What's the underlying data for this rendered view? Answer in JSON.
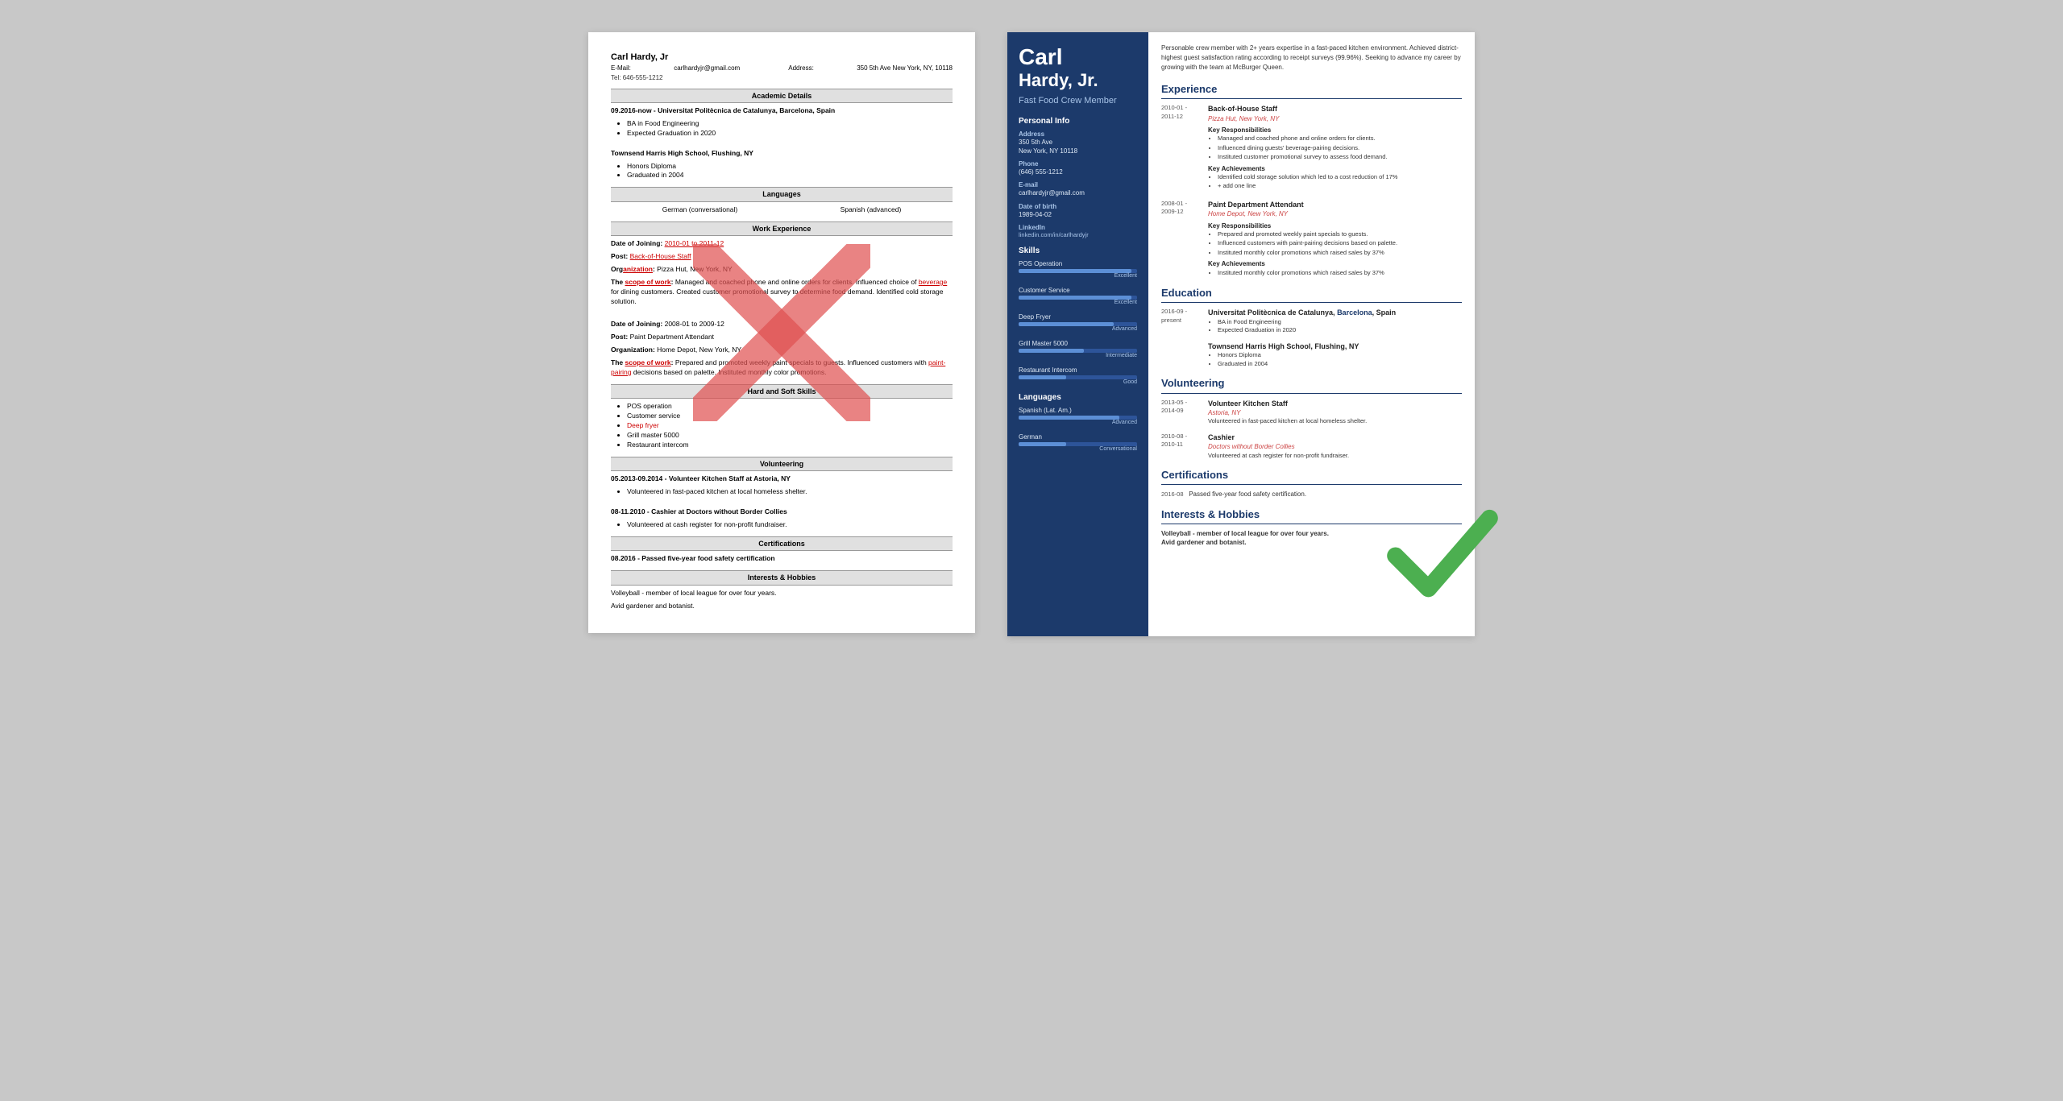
{
  "left_resume": {
    "name": "Carl Hardy, Jr",
    "email_label": "E-Mail:",
    "email": "carlhardyjr@gmail.com",
    "address_label": "Address:",
    "address": "350 5th Ave New York, NY, 10118",
    "tel_label": "Tel:",
    "tel": "646-555-1212",
    "sections": {
      "academic": "Academic Details",
      "languages": "Languages",
      "work": "Work Experience",
      "hardsoft": "Hard and Soft Skills",
      "volunteering": "Volunteering",
      "certifications": "Certifications",
      "interests": "Interests & Hobbies"
    },
    "academic_entries": [
      {
        "dates": "09.2016-now -",
        "school": "Universitat Politècnica de Catalunya, Barcelona, Spain",
        "items": [
          "BA in Food Engineering",
          "Expected Graduation in 2020"
        ]
      },
      {
        "school": "Townsend Harris High School, Flushing, NY",
        "items": [
          "Honors Diploma",
          "Graduated in 2004"
        ]
      }
    ],
    "languages": [
      "German (conversational)",
      "Spanish (advanced)"
    ],
    "work_entries": [
      {
        "dates": "Date of Joining: 2010-01 to 2011-12",
        "post": "Post: Back-of-House Staff",
        "org": "Organization: Pizza Hut, New York, NY",
        "scope": "The scope of work: Managed and coached phone and online orders for clients. Influenced choice of beverage for dining customers. Created customer promotional survey to determine food demand. Identified cold storage solution."
      },
      {
        "dates": "Date of Joining: 2008-01 to 2009-12",
        "post": "Post: Paint Department Attendant",
        "org": "Organization: Home Depot, New York, NY",
        "scope": "The scope of work: Prepared and promoted weekly paint specials to guests. Influenced customers with paint-pairing decisions based on palette. Instituted monthly color promotions."
      }
    ],
    "skills": [
      "POS operation",
      "Customer service",
      "Deep fryer",
      "Grill master 5000",
      "Restaurant intercom"
    ],
    "volunteering_entries": [
      {
        "dates": "05.2013-09.2014",
        "title": "Volunteer Kitchen Staff at Astoria, NY",
        "items": [
          "Volunteered in fast-paced kitchen at local homeless shelter."
        ]
      },
      {
        "dates": "08-11.2010",
        "title": "Cashier at Doctors without Border Collies",
        "items": [
          "Volunteered at cash register for non-profit fundraiser."
        ]
      }
    ],
    "certifications": "08.2016 - Passed five-year food safety certification",
    "interests": "Volleyball - member of local league for over four years.\nAvid gardener and botanist."
  },
  "right_resume": {
    "first_name": "Carl",
    "last_name": "Hardy, Jr.",
    "job_title": "Fast Food Crew Member",
    "intro": "Personable crew member with 2+ years expertise in a fast-paced kitchen environment. Achieved district-highest guest satisfaction rating according to receipt surveys (99.96%). Seeking to advance my career by growing with the team at McBurger Queen.",
    "personal_info": {
      "section": "Personal Info",
      "address_label": "Address",
      "address": "350 5th Ave\nNew York, NY 10118",
      "phone_label": "Phone",
      "phone": "(646) 555-1212",
      "email_label": "E-mail",
      "email": "carlhardyjr@gmail.com",
      "dob_label": "Date of birth",
      "dob": "1989-04-02",
      "linkedin_label": "LinkedIn",
      "linkedin": "linkedin.com/in/carlhardyjr"
    },
    "skills_section": "Skills",
    "skills": [
      {
        "name": "POS Operation",
        "level": "Excellent",
        "pct": 95
      },
      {
        "name": "Customer Service",
        "level": "Excellent",
        "pct": 95
      },
      {
        "name": "Deep Fryer",
        "level": "Advanced",
        "pct": 80
      },
      {
        "name": "Grill Master 5000",
        "level": "Intermediate",
        "pct": 55
      },
      {
        "name": "Restaurant Intercom",
        "level": "Good",
        "pct": 40
      }
    ],
    "languages_section": "Languages",
    "languages": [
      {
        "name": "Spanish (Lat. Am.)",
        "level": "Advanced",
        "pct": 85
      },
      {
        "name": "German",
        "level": "Conversational",
        "pct": 40
      }
    ],
    "experience": {
      "section": "Experience",
      "entries": [
        {
          "dates": "2010-01 -\n2011-12",
          "title": "Back-of-House Staff",
          "company": "Pizza Hut, New York, NY",
          "responsibilities_header": "Key Responsibilities",
          "responsibilities": [
            "Managed and coached phone and online orders for clients.",
            "Influenced dining guests' beverage-pairing decisions.",
            "Instituted customer promotional survey to assess food demand."
          ],
          "achievements_header": "Key Achievements",
          "achievements": [
            "Identified cold storage solution which led to a cost reduction of 17%",
            "+ add one line"
          ]
        },
        {
          "dates": "2008-01 -\n2009-12",
          "title": "Paint Department Attendant",
          "company": "Home Depot, New York, NY",
          "responsibilities_header": "Key Responsibilities",
          "responsibilities": [
            "Prepared and promoted weekly paint specials to guests.",
            "Influenced customers with paint-pairing decisions based on palette.",
            "Instituted monthly color promotions which raised sales by 37%"
          ],
          "achievements_header": "Key Achievements",
          "achievements": [
            "Instituted monthly color promotions which raised sales by 37%"
          ]
        }
      ]
    },
    "education": {
      "section": "Education",
      "entries": [
        {
          "dates": "2016-09 -\npresent",
          "school": "Universitat Politècnica de Catalunya, Barcelona, Spain",
          "highlight": "Barcelona",
          "items": [
            "BA in Food Engineering",
            "Expected Graduation in 2020"
          ]
        },
        {
          "school": "Townsend Harris High School, Flushing, NY",
          "items": [
            "Honors Diploma",
            "Graduated in 2004"
          ]
        }
      ]
    },
    "volunteering": {
      "section": "Volunteering",
      "entries": [
        {
          "dates": "2013-05 -\n2014-09",
          "title": "Volunteer Kitchen Staff",
          "org": "Astoria, NY",
          "desc": "Volunteered in fast-paced kitchen at local homeless shelter."
        },
        {
          "dates": "2010-08 -\n2010-11",
          "title": "Cashier",
          "org": "Doctors without Border Collies",
          "desc": "Volunteered at cash register for non-profit fundraiser."
        }
      ]
    },
    "certifications": {
      "section": "Certifications",
      "entry": "2016-08",
      "text": "Passed five-year food safety certification."
    },
    "interests": {
      "section": "Interests & Hobbies",
      "entries": [
        "Volleyball - member of local league for over four years.",
        "Avid gardener and botanist."
      ]
    }
  }
}
